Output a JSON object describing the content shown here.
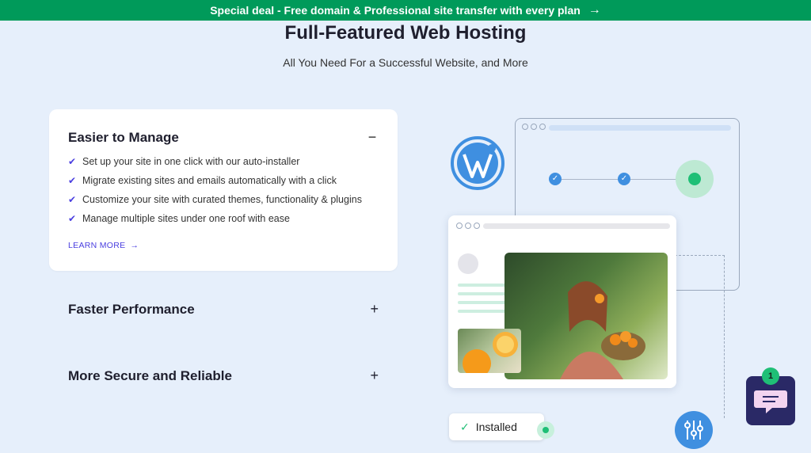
{
  "promo_banner": {
    "text": "Special deal - Free domain & Professional site transfer with every plan",
    "arrow": "→"
  },
  "header": {
    "title": "Full-Featured Web Hosting",
    "subtitle": "All You Need For a Successful Website, and More"
  },
  "accordion": {
    "expanded": {
      "title": "Easier to Manage",
      "toggle": "−",
      "features": [
        "Set up your site in one click with our auto-installer",
        "Migrate existing sites and emails automatically with a click",
        "Customize your site with curated themes, functionality & plugins",
        "Manage multiple sites under one roof with ease"
      ],
      "learn_more": "LEARN MORE",
      "learn_more_arrow": "→"
    },
    "collapsed": [
      {
        "title": "Faster Performance",
        "toggle": "+"
      },
      {
        "title": "More Secure and Reliable",
        "toggle": "+"
      }
    ]
  },
  "illustration": {
    "installed_label": "Installed",
    "check_glyph": "✓"
  },
  "chat_widget": {
    "badge_count": "1",
    "icon": "chat-icon"
  },
  "colors": {
    "promo_bg": "#009a5a",
    "page_bg": "#e6effb",
    "accent_purple": "#4a3fe0",
    "accent_green": "#1fbf76",
    "accent_blue": "#3f8fe0",
    "chat_bg": "#2a2966"
  }
}
